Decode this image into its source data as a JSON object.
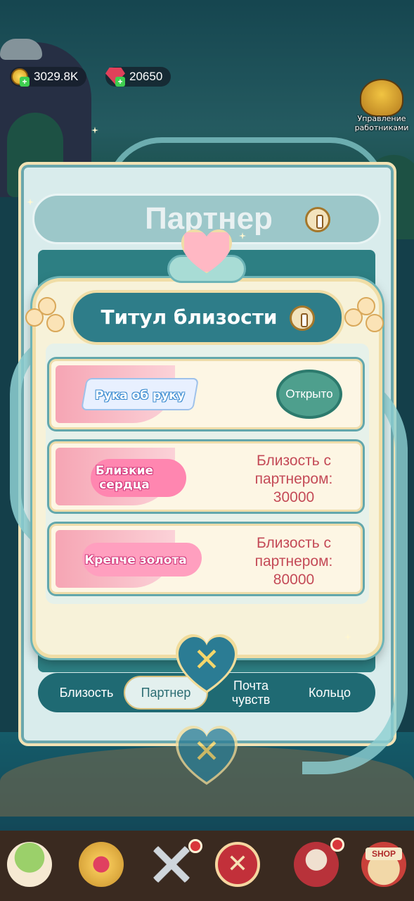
{
  "hud": {
    "coins": "3029.8K",
    "gems": "20650",
    "worker_management_label": "Управление работниками"
  },
  "back_panel": {
    "title": "Партнер",
    "tabs": [
      {
        "label": "Близость",
        "active": false
      },
      {
        "label": "Партнер",
        "active": true
      },
      {
        "label": "Почта чувств",
        "active": false
      },
      {
        "label": "Кольцо",
        "active": false
      }
    ]
  },
  "dialog": {
    "title": "Титул близости",
    "rows": [
      {
        "badge": "Рука об руку",
        "status": "Открыто"
      },
      {
        "badge": "Близкие сердца",
        "requirement_label": "Близость с партнером:",
        "requirement_value": "30000"
      },
      {
        "badge": "Крепче золота",
        "requirement_label": "Близость с партнером:",
        "requirement_value": "80000"
      }
    ]
  },
  "bottom_nav": {
    "shop_label": "SHOP"
  },
  "colors": {
    "accent_teal": "#2e7d89",
    "requirement_red": "#c44a57",
    "unlocked_green": "#4e9f8d"
  }
}
